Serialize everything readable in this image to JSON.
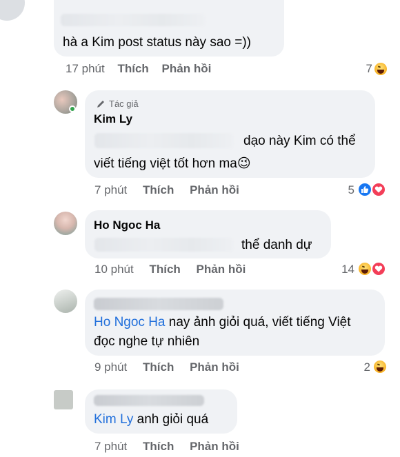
{
  "comments": [
    {
      "text": "hà a Kim post status này sao =))",
      "time": "17 phút",
      "like_label": "Thích",
      "reply_label": "Phản hồi",
      "reaction_count": "7"
    },
    {
      "badge": "Tác giả",
      "name": "Kim Ly",
      "text_line1": "dạo này Kim có thể",
      "text_line2": "viết tiếng việt tốt hơn ma",
      "emoji": "😉",
      "time": "7 phút",
      "like_label": "Thích",
      "reply_label": "Phản hồi",
      "reaction_count": "5"
    },
    {
      "name": "Ho Ngoc Ha",
      "text": "thể danh dự",
      "time": "10 phút",
      "like_label": "Thích",
      "reply_label": "Phản hồi",
      "reaction_count": "14"
    },
    {
      "mention": "Ho Ngoc Ha",
      "text_line1": "nay ảnh giỏi quá, viết tiếng Việt",
      "text_line2": "đọc nghe tự nhiên",
      "time": "9 phút",
      "like_label": "Thích",
      "reply_label": "Phản hồi",
      "reaction_count": "2"
    },
    {
      "mention": "Kim Ly",
      "text": "anh giỏi quá",
      "time": "7 phút",
      "like_label": "Thích",
      "reply_label": "Phản hồi"
    }
  ],
  "icons": {
    "reactions": [
      "haha-reaction-icon",
      "like-reaction-icon",
      "love-reaction-icon"
    ],
    "author_badge": "pencil-icon"
  },
  "colors": {
    "bubble": "#f0f2f5",
    "mention": "#216fdb",
    "meta": "#65676b",
    "like": "#1877f2",
    "love": "#f33e58",
    "online": "#31a24c"
  }
}
